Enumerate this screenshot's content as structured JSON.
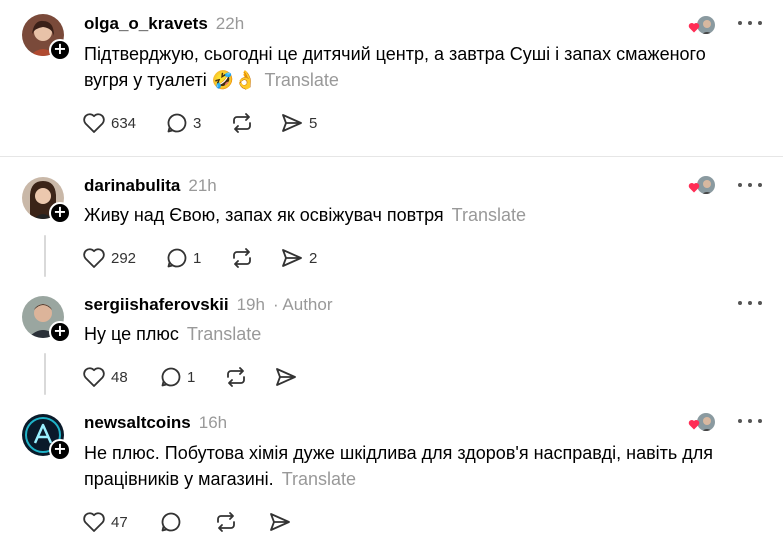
{
  "comments": [
    {
      "username": "olga_o_kravets",
      "time": "22h",
      "text": "Підтверджую, сьогодні це дитячий центр, а завтра Суші і запах смаженого вугря у туалеті 🤣👌",
      "translate": "Translate",
      "likes": "634",
      "replies": "3",
      "reposts": "",
      "shares": "5",
      "author_liked": true
    },
    {
      "username": "darinabulita",
      "time": "21h",
      "text": "Живу над Євою, запах як освіжувач повтря",
      "translate": "Translate",
      "likes": "292",
      "replies": "1",
      "reposts": "",
      "shares": "2",
      "author_liked": true
    },
    {
      "username": "sergiishaferovskii",
      "time": "19h",
      "author_tag": "· Author",
      "text": "Ну це плюс",
      "translate": "Translate",
      "likes": "48",
      "replies": "1",
      "reposts": "",
      "shares": "",
      "author_liked": false
    },
    {
      "username": "newsaltcoins",
      "time": "16h",
      "text": "Не плюс. Побутова хімія дуже шкідлива для здоров'я насправді, навіть для працівників у магазині.",
      "translate": "Translate",
      "likes": "47",
      "replies": "",
      "reposts": "",
      "shares": "",
      "author_liked": true
    }
  ],
  "icons": {
    "like": "heart-icon",
    "reply": "speech-bubble-icon",
    "repost": "repost-arrows-icon",
    "share": "paper-plane-icon",
    "more": "three-dots-icon",
    "follow": "plus-icon"
  },
  "colors": {
    "text": "#000000",
    "muted": "#999999",
    "liked_heart": "#ff2d55",
    "divider": "#e6e6e6"
  }
}
